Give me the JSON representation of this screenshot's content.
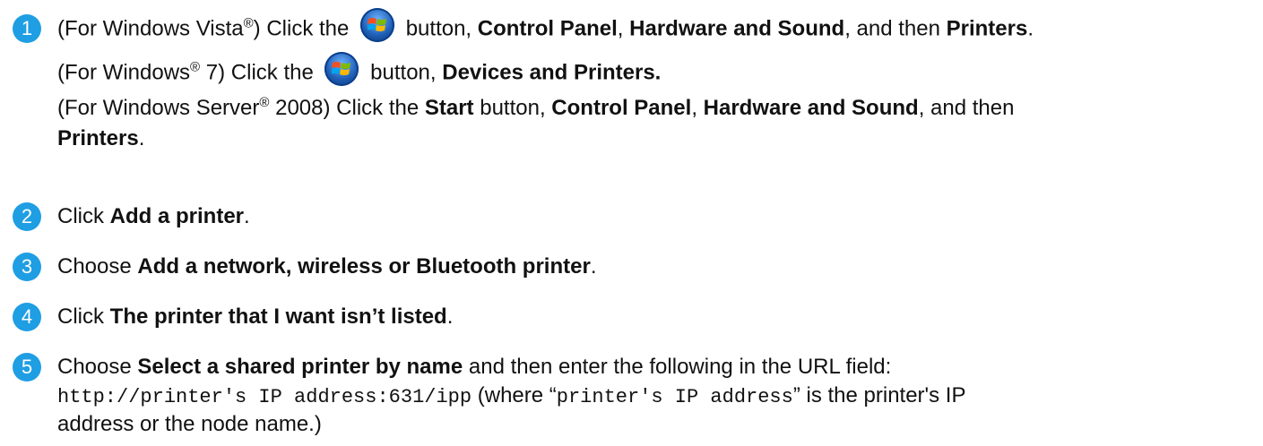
{
  "steps": [
    {
      "number": "1",
      "lines": [
        {
          "p1": "(For Windows Vista",
          "sup1": "®",
          "p2": ") Click the",
          "p3": "button,",
          "b1": "Control Panel",
          "p4": ",",
          "b2": "Hardware and Sound",
          "p5": ", and then",
          "b3": "Printers",
          "p6": "."
        },
        {
          "p1": "(For Windows",
          "sup1": "®",
          "p2": "7) Click the",
          "p3": "button,",
          "b1": "Devices and Printers."
        },
        {
          "p1": "(For Windows Server",
          "sup1": "®",
          "p2": "2008) Click the",
          "b1": "Start",
          "p3": "button,",
          "b2": "Control Panel",
          "p4": ",",
          "b3": "Hardware and Sound",
          "p5": ", and then"
        },
        {
          "b1": "Printers",
          "p1": "."
        }
      ]
    },
    {
      "number": "2",
      "pre": "Click",
      "bold": "Add a printer",
      "post": "."
    },
    {
      "number": "3",
      "pre": "Choose",
      "bold": "Add a network, wireless or Bluetooth printer",
      "post": "."
    },
    {
      "number": "4",
      "pre": "Click",
      "bold": "The printer that I want isn’t listed",
      "post": "."
    },
    {
      "number": "5",
      "l1_pre": "Choose",
      "l1_bold": "Select a shared printer by name",
      "l1_post": "and then enter the following in the URL field:",
      "l2_code1": "http://printer's IP address:631/ipp",
      "l2_p1": "(where “",
      "l2_code2": "printer's IP address",
      "l2_p2": "” is the printer's IP",
      "l3": "address or the node name.)"
    }
  ],
  "icons": {
    "start_button": "windows-start-orb-icon",
    "step_marker_color": "#1f9ee3"
  }
}
